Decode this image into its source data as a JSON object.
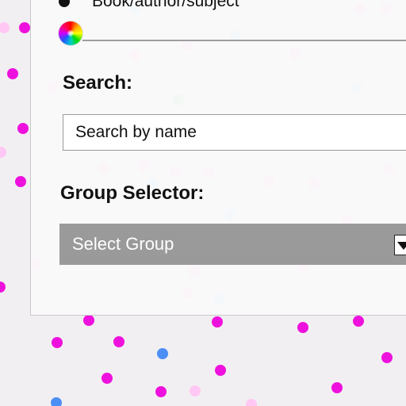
{
  "view_options": {
    "radio_book_label": "Book/author/subject"
  },
  "search": {
    "heading": "Search:",
    "placeholder": "Search by name"
  },
  "group_selector": {
    "heading": "Group Selector:",
    "selected": "Select Group"
  },
  "colors": {
    "background": "#f1eff2",
    "select_background": "#9a9a9a",
    "dot_magenta": "#ee11dd",
    "dot_pink_light": "#ffc8f4",
    "dot_blue": "#4d8ff5",
    "dot_blue_light": "#cfe0f7"
  }
}
